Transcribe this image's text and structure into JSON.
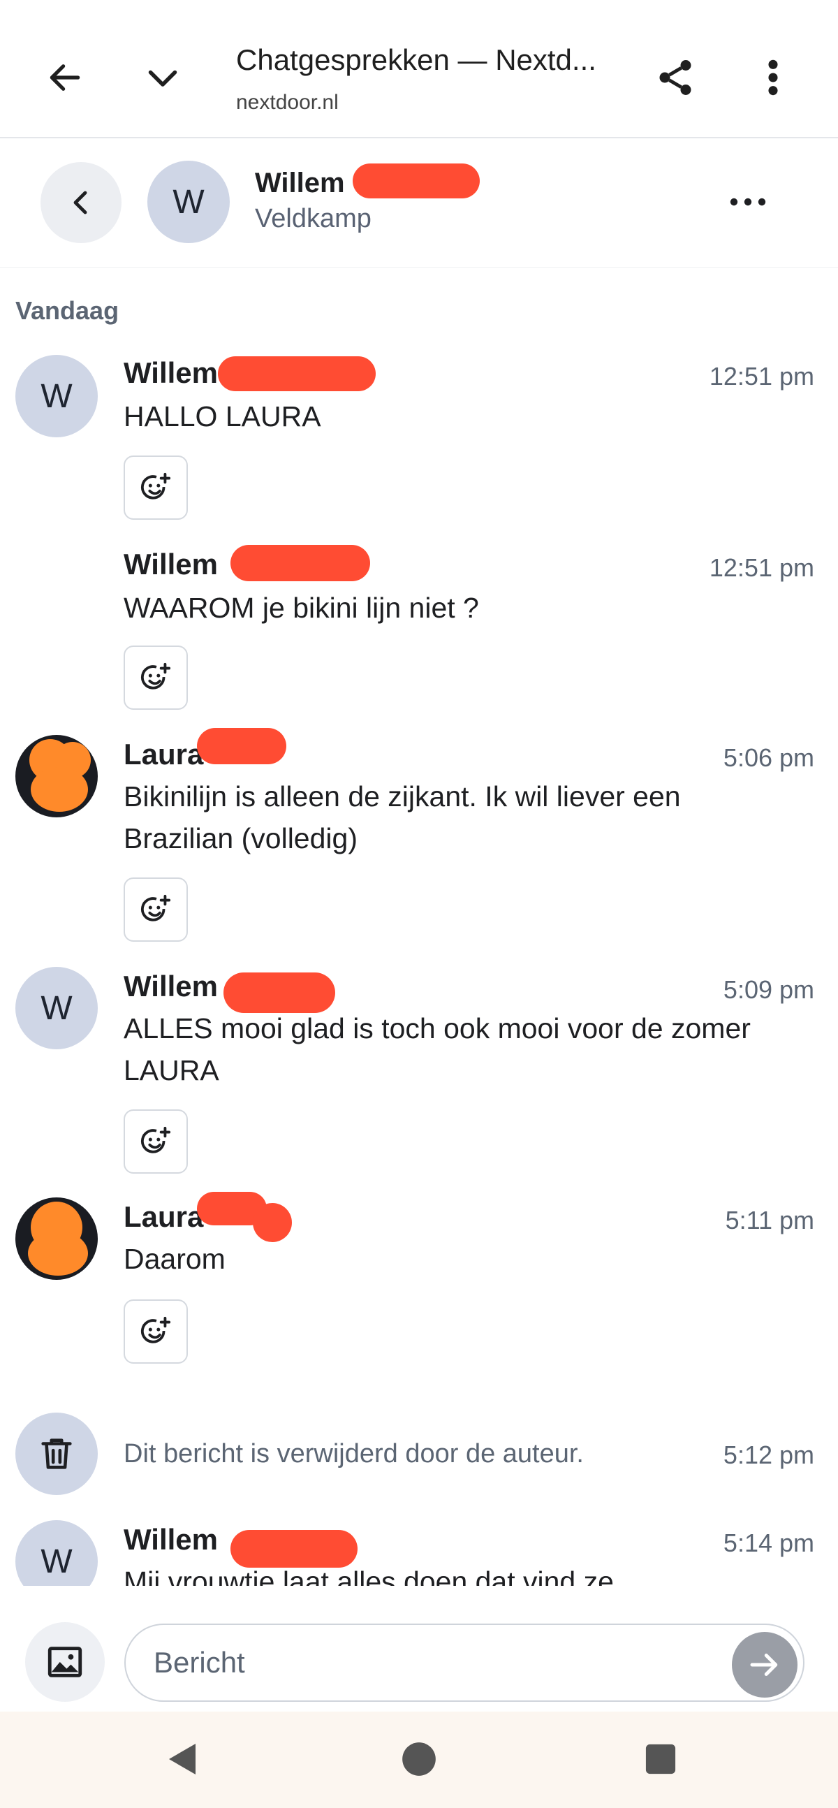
{
  "browser": {
    "title": "Chatgesprekken — Nextd...",
    "url": "nextdoor.nl"
  },
  "chat_header": {
    "contact_initial": "W",
    "contact_name": "Willem",
    "contact_location": "Veldkamp"
  },
  "date_label": "Vandaag",
  "messages": [
    {
      "initial": "W",
      "sender": "Willem",
      "time": "12:51 pm",
      "text": "HALLO LAURA"
    },
    {
      "sender": "Willem",
      "time": "12:51 pm",
      "text": "WAAROM je bikini lijn niet ?"
    },
    {
      "sender": "Laura",
      "time": "5:06 pm",
      "text": "Bikinilijn is alleen de zijkant. Ik wil liever een Brazilian (volledig)"
    },
    {
      "initial": "W",
      "sender": "Willem",
      "time": "5:09 pm",
      "text": "ALLES mooi glad is toch ook mooi voor de zomer LAURA"
    },
    {
      "sender": "Laura",
      "time": "5:11 pm",
      "text": "Daarom"
    },
    {
      "deleted_text": "Dit bericht is verwijderd door de auteur.",
      "time": "5:12 pm"
    },
    {
      "initial": "W",
      "sender": "Willem",
      "time": "5:14 pm",
      "text": "Mij vrouwtje laat alles doen dat vind ze"
    }
  ],
  "composer": {
    "placeholder": "Bericht"
  },
  "colors": {
    "redaction": "#ff4c33",
    "avatar_bg": "#cfd6e6",
    "muted_text": "#5b6573",
    "send_button": "#9a9ea6"
  },
  "icons": [
    "back-arrow-icon",
    "chevron-down-icon",
    "share-icon",
    "more-vertical-icon",
    "chevron-left-icon",
    "more-horizontal-icon",
    "add-reaction-icon",
    "trash-icon",
    "image-icon",
    "send-arrow-icon",
    "nav-back-icon",
    "nav-home-icon",
    "nav-recents-icon"
  ]
}
